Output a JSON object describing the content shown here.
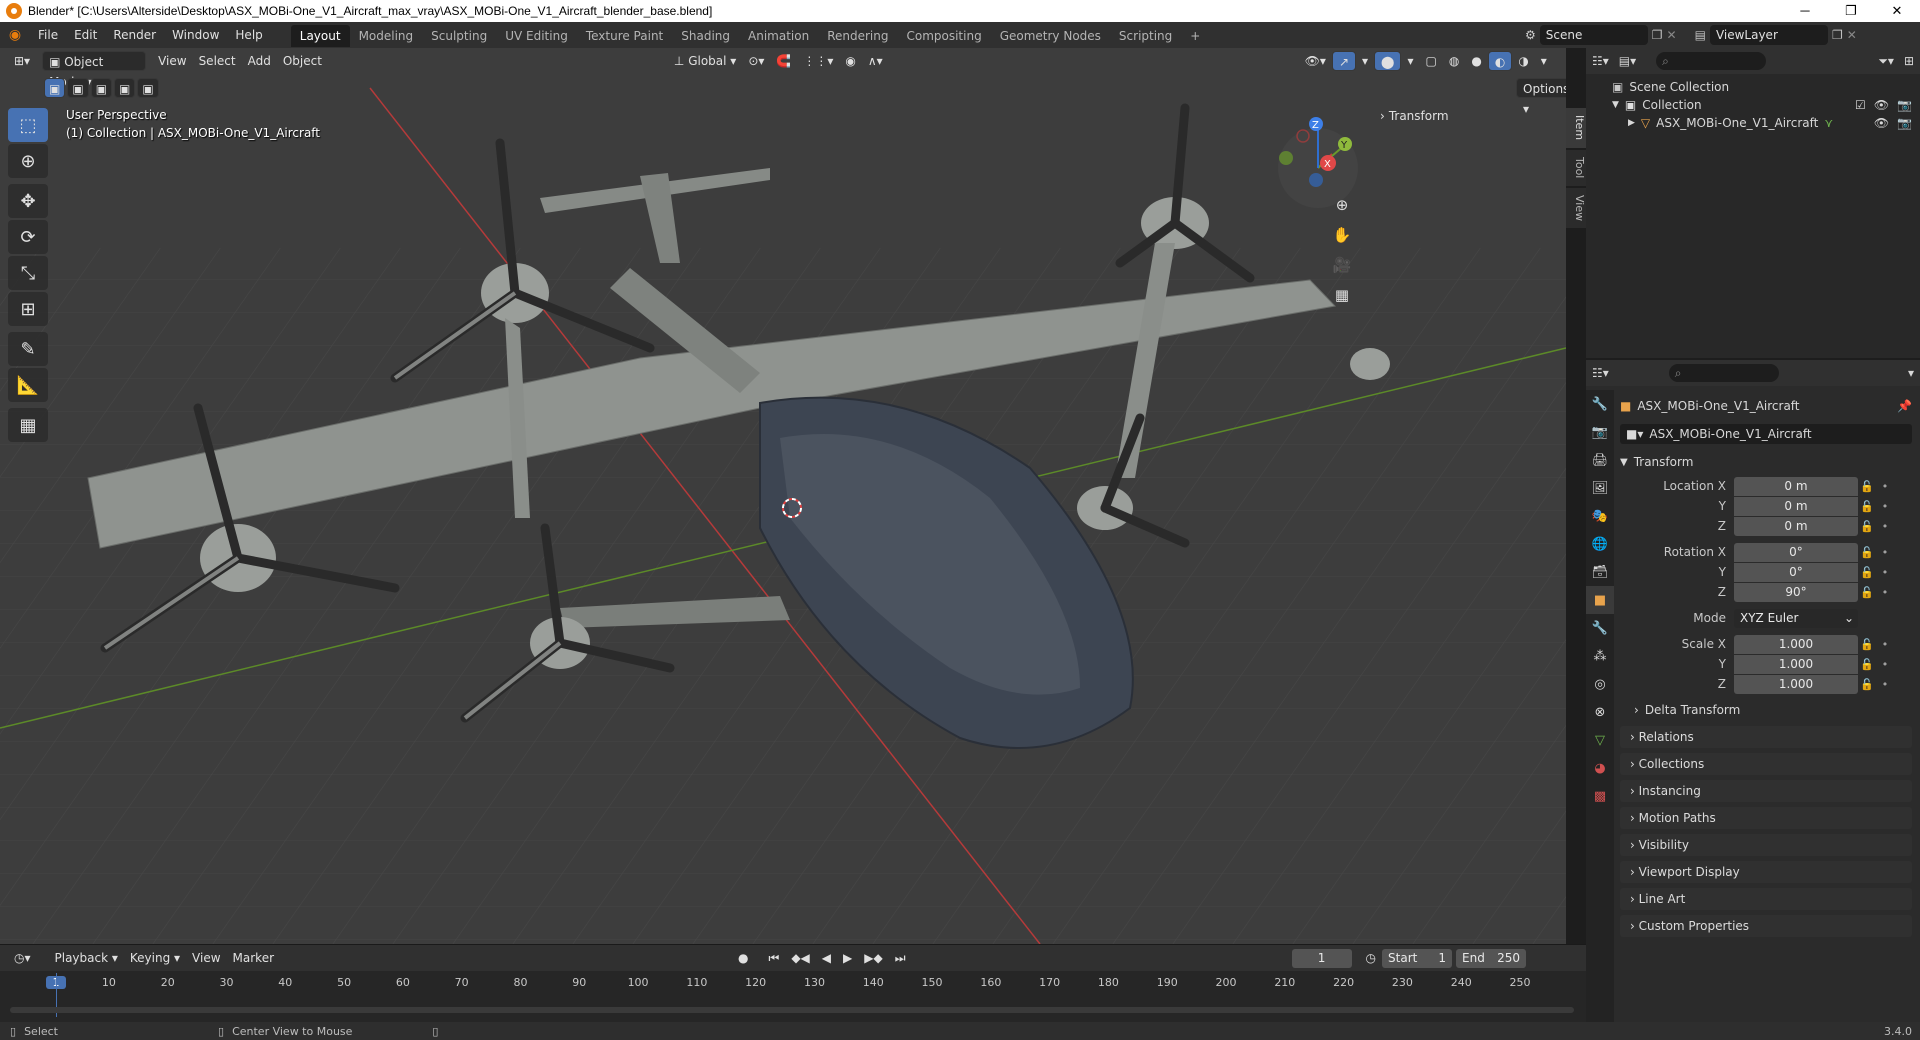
{
  "title": "Blender* [C:\\Users\\Alterside\\Desktop\\ASX_MOBi-One_V1_Aircraft_max_vray\\ASX_MOBi-One_V1_Aircraft_blender_base.blend]",
  "window_buttons": {
    "minimize": "─",
    "restore": "❐",
    "close": "✕"
  },
  "menus": [
    "File",
    "Edit",
    "Render",
    "Window",
    "Help"
  ],
  "workspaces": [
    {
      "label": "Layout",
      "active": true
    },
    {
      "label": "Modeling"
    },
    {
      "label": "Sculpting"
    },
    {
      "label": "UV Editing"
    },
    {
      "label": "Texture Paint"
    },
    {
      "label": "Shading"
    },
    {
      "label": "Animation"
    },
    {
      "label": "Rendering"
    },
    {
      "label": "Compositing"
    },
    {
      "label": "Geometry Nodes"
    },
    {
      "label": "Scripting"
    }
  ],
  "add_workspace": "+",
  "scene": "Scene",
  "view_layer": "ViewLayer",
  "viewport": {
    "mode": "Object Mode",
    "menus": [
      "View",
      "Select",
      "Add",
      "Object"
    ],
    "orientation": "Global",
    "options": "Options",
    "perspective": "User Perspective",
    "collection_info": "(1) Collection | ASX_MOBi-One_V1_Aircraft",
    "transform_panel": "Transform",
    "side_tabs": [
      "Item",
      "Tool",
      "View"
    ],
    "gizmo": {
      "x": "X",
      "y": "Y",
      "z": "Z"
    }
  },
  "outliner": {
    "root": "Scene Collection",
    "collection": "Collection",
    "object": "ASX_MOBi-One_V1_Aircraft"
  },
  "properties": {
    "object_name": "ASX_MOBi-One_V1_Aircraft",
    "data_name": "ASX_MOBi-One_V1_Aircraft",
    "transform_header": "Transform",
    "location": {
      "label": "Location X",
      "x": "0 m",
      "y": "0 m",
      "z": "0 m"
    },
    "rotation": {
      "label": "Rotation X",
      "x": "0°",
      "y": "0°",
      "z": "90°"
    },
    "mode_label": "Mode",
    "mode_value": "XYZ Euler",
    "scale": {
      "label": "Scale X",
      "x": "1.000",
      "y": "1.000",
      "z": "1.000"
    },
    "axis_y": "Y",
    "axis_z": "Z",
    "delta": "Delta Transform",
    "sections": [
      "Relations",
      "Collections",
      "Instancing",
      "Motion Paths",
      "Visibility",
      "Viewport Display",
      "Line Art",
      "Custom Properties"
    ]
  },
  "timeline": {
    "menus": [
      "Playback",
      "Keying",
      "View",
      "Marker"
    ],
    "current_frame": "1",
    "start_label": "Start",
    "start": "1",
    "end_label": "End",
    "end": "250",
    "ticks": [
      "1",
      "10",
      "20",
      "30",
      "40",
      "50",
      "60",
      "70",
      "80",
      "90",
      "100",
      "110",
      "120",
      "130",
      "140",
      "150",
      "160",
      "170",
      "180",
      "190",
      "200",
      "210",
      "220",
      "230",
      "240",
      "250"
    ]
  },
  "status": {
    "select": "Select",
    "center": "Center View to Mouse",
    "version": "3.4.0"
  },
  "colors": {
    "accent": "#4772b3",
    "x_axis": "#c43b3b",
    "y_axis": "#6a9a2b",
    "z_axis": "#2f6fd0",
    "viewport_bg": "#3d3d3d"
  }
}
